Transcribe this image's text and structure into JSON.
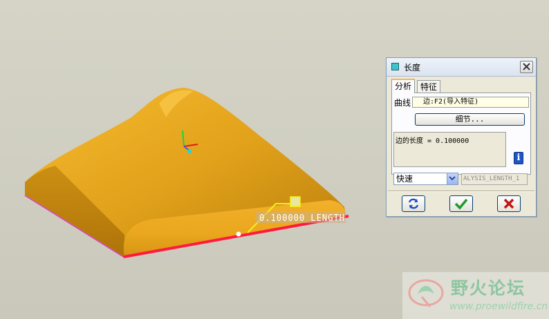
{
  "viewport": {
    "dimension_text": "0.100000 LENGTH",
    "colors": {
      "model": "#e0a41c",
      "selected_edge": "#ff1a3c",
      "background": "#d2d1c4"
    }
  },
  "dialog": {
    "title": "长度",
    "tabs": [
      {
        "label": "分析",
        "active": true
      },
      {
        "label": "特征",
        "active": false
      }
    ],
    "curve_label": "曲线",
    "curve_value": "边:F2(导入特征)",
    "detail_button": "细节...",
    "result_text": "边的长度 = 0.100000",
    "mode_value": "快速",
    "feature_name": "ALYSIS_LENGTH_1",
    "buttons": {
      "repeat": "repeat-icon",
      "ok": "check-icon",
      "cancel": "x-icon"
    }
  },
  "watermark": {
    "title": "野火论坛",
    "url": "www.proewildfire.cn"
  }
}
